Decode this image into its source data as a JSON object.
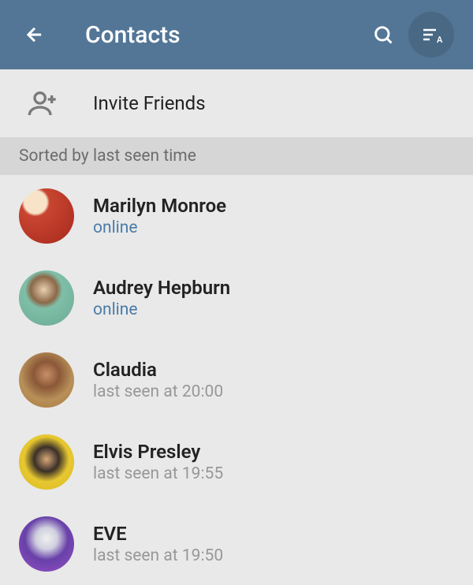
{
  "header": {
    "title": "Contacts"
  },
  "invite": {
    "label": "Invite Friends"
  },
  "sort": {
    "label": "Sorted by last seen time"
  },
  "contacts": [
    {
      "name": "Marilyn Monroe",
      "status": "online",
      "status_type": "online"
    },
    {
      "name": "Audrey Hepburn",
      "status": "online",
      "status_type": "online"
    },
    {
      "name": "Claudia",
      "status": "last seen at 20:00",
      "status_type": "seen"
    },
    {
      "name": "Elvis Presley",
      "status": "last seen at 19:55",
      "status_type": "seen"
    },
    {
      "name": "EVE",
      "status": "last seen at 19:50",
      "status_type": "seen"
    }
  ]
}
